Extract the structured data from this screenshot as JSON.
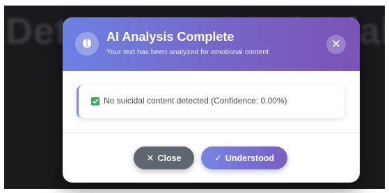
{
  "background": {
    "heading": "Detection of Suicidal"
  },
  "modal": {
    "title": "AI Analysis Complete",
    "subtitle": "Your text has been analyzed for emotional content",
    "icon": "brain-icon",
    "close_icon": "✕"
  },
  "result": {
    "icon": "checkbox-check-icon",
    "text": "No suicidal content detected (Confidence: 0.00%)",
    "status_color": "#3cab5a"
  },
  "buttons": {
    "close_glyph": "✕",
    "close_label": "Close",
    "ok_glyph": "✓",
    "ok_label": "Understood"
  },
  "colors": {
    "header_gradient_start": "#6c82e3",
    "header_gradient_end": "#7a53b5",
    "close_button": "#5f6670",
    "accent": "#7e8fe0"
  }
}
